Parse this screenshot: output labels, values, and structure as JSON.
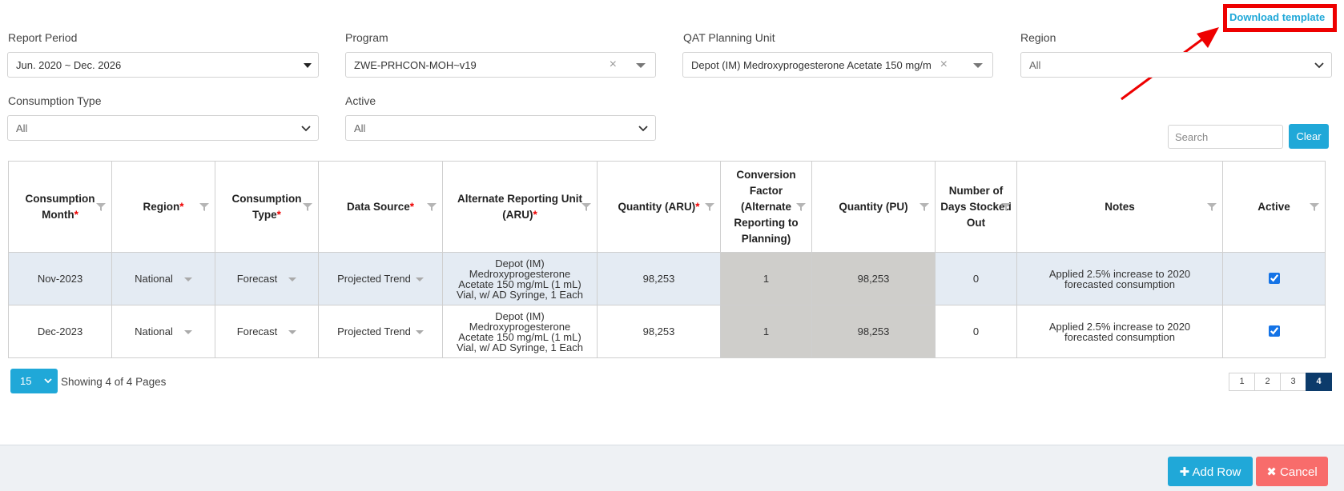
{
  "download_template": "Download template",
  "filters": {
    "report_period": {
      "label": "Report Period",
      "value": "Jun. 2020 ~ Dec. 2026"
    },
    "program": {
      "label": "Program",
      "value": "ZWE-PRHCON-MOH~v19"
    },
    "planning_unit": {
      "label": "QAT Planning Unit",
      "value": "Depot (IM) Medroxyprogesterone Acetate 150 mg/m"
    },
    "region": {
      "label": "Region",
      "value": "All"
    },
    "consumption_type": {
      "label": "Consumption Type",
      "value": "All"
    },
    "active": {
      "label": "Active",
      "value": "All"
    }
  },
  "search": {
    "placeholder": "Search",
    "clear_label": "Clear"
  },
  "table": {
    "columns": [
      {
        "line1": "Consumption",
        "line2": "Month",
        "required": "*"
      },
      {
        "line1": "Region",
        "line2": "",
        "required": "*"
      },
      {
        "line1": "Consumption",
        "line2": "Type",
        "required": "*"
      },
      {
        "line1": "Data Source",
        "line2": "",
        "required": "*"
      },
      {
        "line1": "Alternate Reporting Unit",
        "line2": "(ARU)",
        "required": "*"
      },
      {
        "line1": "Quantity (ARU)",
        "line2": "",
        "required": "*"
      },
      {
        "line1": "Conversion Factor (Alternate Reporting to Planning)",
        "line2": "",
        "required": ""
      },
      {
        "line1": "Quantity (PU)",
        "line2": "",
        "required": ""
      },
      {
        "line1": "Number of Days Stocked Out",
        "line2": "",
        "required": ""
      },
      {
        "line1": "Notes",
        "line2": "",
        "required": ""
      },
      {
        "line1": "Active",
        "line2": "",
        "required": ""
      }
    ],
    "rows": [
      {
        "month": "Nov-2023",
        "region": "National",
        "consumption_type": "Forecast",
        "data_source": "Projected Trend",
        "aru_l1": "Depot (IM)",
        "aru_l2": "Medroxyprogesterone",
        "aru_l3": "Acetate 150 mg/mL (1 mL)",
        "aru_l4": "Vial, w/ AD Syringe, 1 Each",
        "qty_aru": "98,253",
        "conversion": "1",
        "qty_pu": "98,253",
        "days_out": "0",
        "notes_l1": "Applied 2.5% increase to 2020",
        "notes_l2": "forecasted consumption",
        "active": true
      },
      {
        "month": "Dec-2023",
        "region": "National",
        "consumption_type": "Forecast",
        "data_source": "Projected Trend",
        "aru_l1": "Depot (IM)",
        "aru_l2": "Medroxyprogesterone",
        "aru_l3": "Acetate 150 mg/mL (1 mL)",
        "aru_l4": "Vial, w/ AD Syringe, 1 Each",
        "qty_aru": "98,253",
        "conversion": "1",
        "qty_pu": "98,253",
        "days_out": "0",
        "notes_l1": "Applied 2.5% increase to 2020",
        "notes_l2": "forecasted consumption",
        "active": true
      }
    ]
  },
  "pagination": {
    "per_page": "15",
    "showing": "Showing 4 of 4 Pages",
    "pages": [
      "1",
      "2",
      "3",
      "4"
    ],
    "active_page": "4"
  },
  "footer": {
    "add_row": "Add Row",
    "cancel": "Cancel"
  },
  "colors": {
    "accent": "#20a8d8",
    "danger": "#f86c6b",
    "highlight": "#ee0000",
    "active_page": "#0c3b6b"
  }
}
